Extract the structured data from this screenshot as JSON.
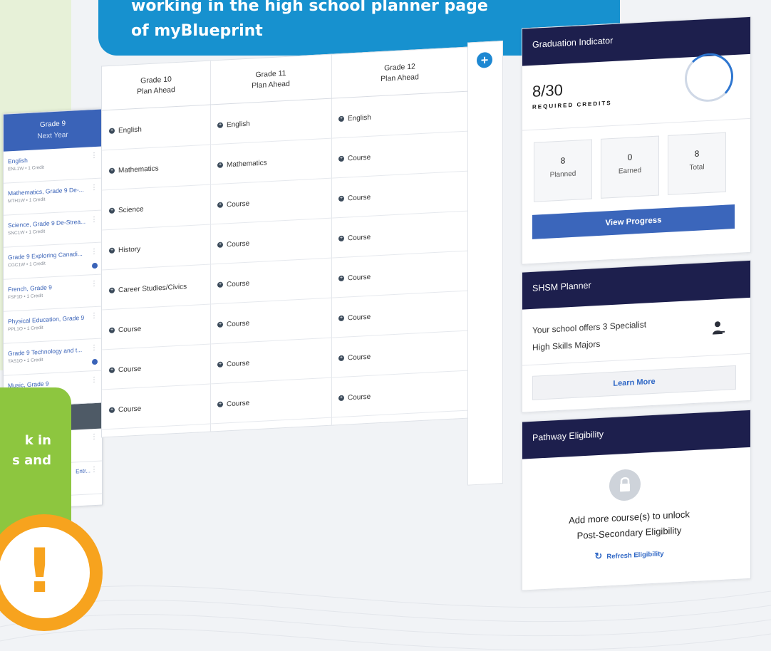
{
  "banner": {
    "line1": "working in the high school planner page",
    "line2": "of myBlueprint"
  },
  "grade9": {
    "title": "Grade 9",
    "subtitle": "Next Year",
    "courses": [
      {
        "name": "English",
        "code": "ENL1W • 1 Credit"
      },
      {
        "name": "Mathematics, Grade 9 De-...",
        "code": "MTH1W • 1 Credit"
      },
      {
        "name": "Science, Grade 9 De-Strea...",
        "code": "SNC1W • 1 Credit"
      },
      {
        "name": "Grade 9 Exploring Canadi...",
        "code": "CGC1W • 1 Credit"
      },
      {
        "name": "French, Grade 9",
        "code": "FSF1D • 1 Credit"
      },
      {
        "name": "Physical Education, Grade 9",
        "code": "PPL1O • 1 Credit"
      },
      {
        "name": "Grade 9 Technology and t...",
        "code": "TAS1O • 1 Credit"
      },
      {
        "name": "Music, Grade 9",
        "code": ""
      }
    ],
    "extra_truncated": "Entr..."
  },
  "planner": {
    "columns": [
      {
        "title": "Grade 10",
        "subtitle": "Plan Ahead",
        "cells": [
          "English",
          "Mathematics",
          "Science",
          "History",
          "Career Studies/Civics",
          "Course",
          "Course",
          "Course"
        ]
      },
      {
        "title": "Grade 11",
        "subtitle": "Plan Ahead",
        "cells": [
          "English",
          "Mathematics",
          "Course",
          "Course",
          "Course",
          "Course",
          "Course",
          "Course"
        ]
      },
      {
        "title": "Grade 12",
        "subtitle": "Plan Ahead",
        "cells": [
          "English",
          "Course",
          "Course",
          "Course",
          "Course",
          "Course",
          "Course",
          "Course"
        ]
      }
    ],
    "add_label": "+"
  },
  "graduation": {
    "title": "Graduation Indicator",
    "credits": "8/30",
    "credits_label": "REQUIRED CREDITS",
    "progress_fraction": 0.27,
    "stats": [
      {
        "value": "8",
        "label": "Planned"
      },
      {
        "value": "0",
        "label": "Earned"
      },
      {
        "value": "8",
        "label": "Total"
      }
    ],
    "view_button": "View Progress"
  },
  "shsm": {
    "title": "SHSM Planner",
    "line1": "Your school offers 3 Specialist",
    "line2": "High Skills Majors",
    "learn_button": "Learn More"
  },
  "pathway": {
    "title": "Pathway Eligibility",
    "msg1": "Add more course(s) to unlock",
    "msg2": "Post-Secondary Eligibility",
    "refresh": "Refresh Eligibility"
  },
  "callout": {
    "line1": "k in",
    "line2": "s and"
  },
  "warning": {
    "symbol": "!"
  }
}
